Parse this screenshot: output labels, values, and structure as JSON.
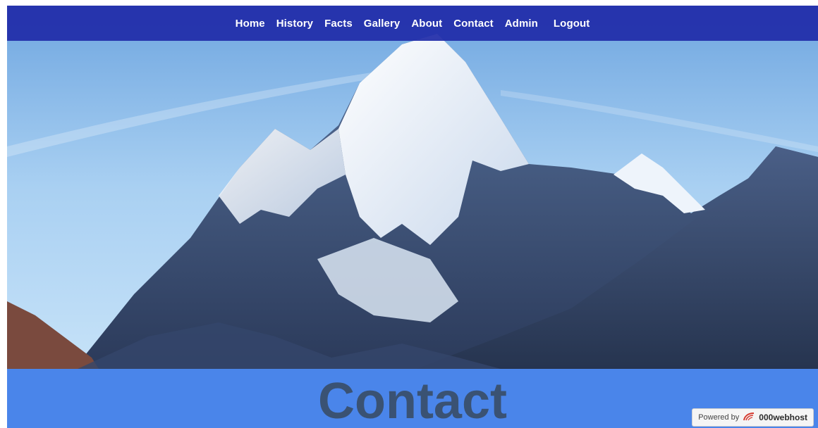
{
  "nav": {
    "items": [
      {
        "label": "Home"
      },
      {
        "label": "History"
      },
      {
        "label": "Facts"
      },
      {
        "label": "Gallery"
      },
      {
        "label": "About"
      },
      {
        "label": "Contact"
      },
      {
        "label": "Admin"
      }
    ],
    "logout_label": "Logout"
  },
  "page": {
    "title": "Contact"
  },
  "badge": {
    "prefix": "Powered by",
    "brand": "000webhost",
    "icon": "flame-icon"
  },
  "colors": {
    "navbar": "#1f2aa8",
    "banner": "#4a85ea",
    "title": "#3a5273",
    "sky": "#9fc8ee"
  }
}
